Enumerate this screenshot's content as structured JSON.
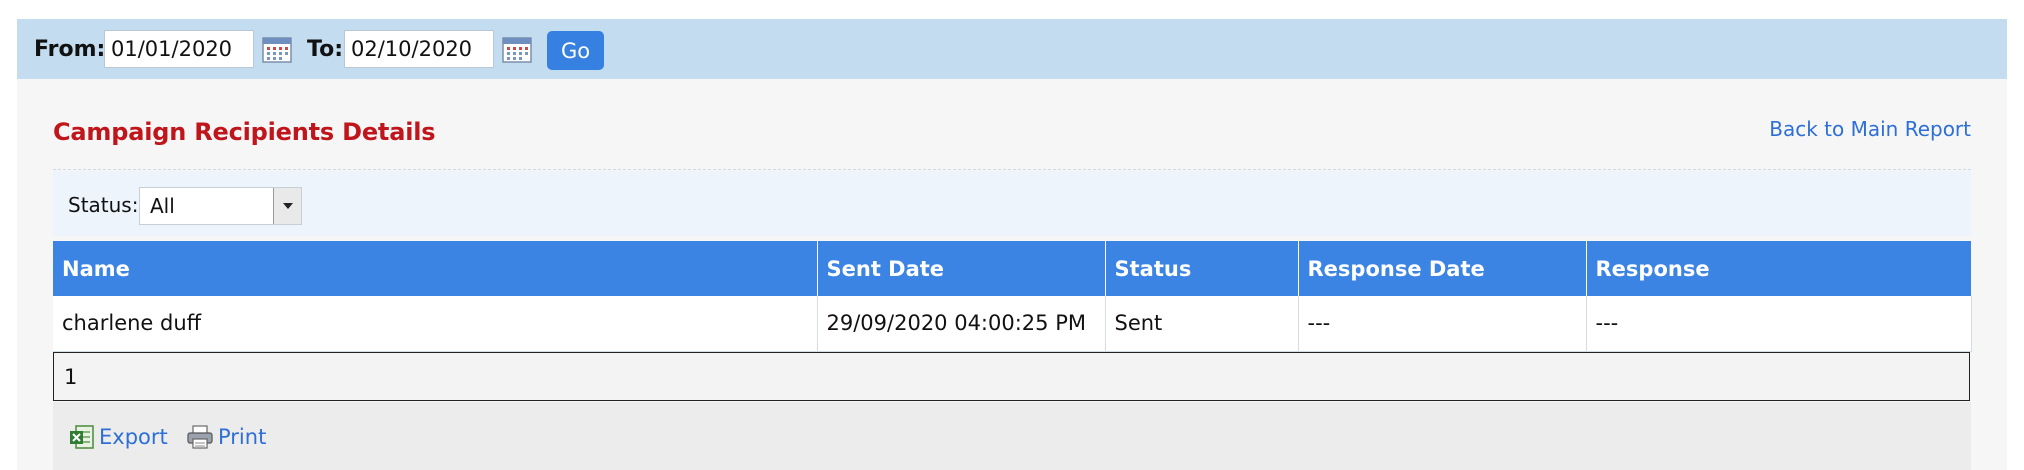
{
  "filter": {
    "from_label": "From:",
    "from_value": "01/01/2020",
    "to_label": "To:",
    "to_value": "02/10/2020",
    "go_label": "Go",
    "icon": "calendar-icon"
  },
  "report": {
    "title": "Campaign Recipients Details",
    "back_link": "Back to Main Report"
  },
  "status_filter": {
    "label": "Status:",
    "selected": "All"
  },
  "table": {
    "columns": [
      "Name",
      "Sent Date",
      "Status",
      "Response Date",
      "Response"
    ],
    "rows": [
      [
        "charlene duff",
        "29/09/2020 04:00:25 PM",
        "Sent",
        "---",
        "---"
      ]
    ]
  },
  "pager": {
    "page": "1"
  },
  "actions": {
    "export_label": "Export",
    "print_label": "Print"
  },
  "colors": {
    "filter_bar": "#c4dcef",
    "accent_blue": "#3b84e3",
    "title_red": "#c0151b",
    "link_blue": "#2d6fd6"
  }
}
